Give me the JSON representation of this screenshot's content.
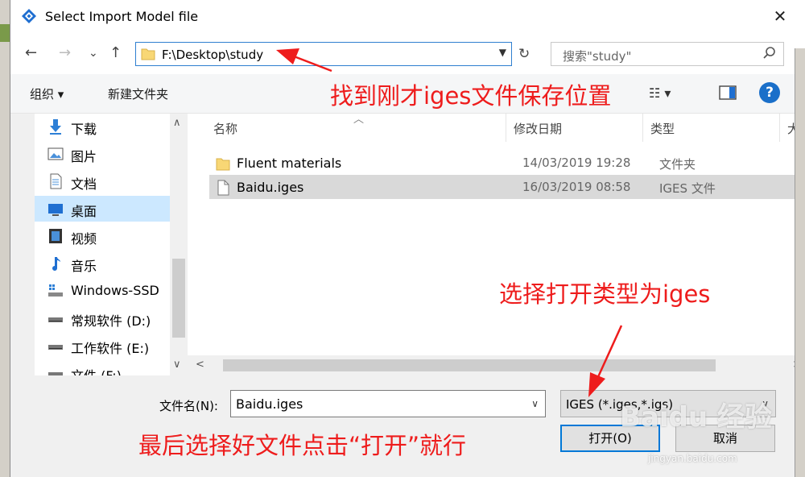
{
  "window": {
    "title": "Select Import Model file",
    "close_glyph": "✕"
  },
  "nav": {
    "back_glyph": "←",
    "forward_glyph": "→",
    "recent_glyph": "⌄",
    "up_glyph": "↑",
    "address_path": "F:\\Desktop\\study",
    "refresh_glyph": "↻",
    "search_placeholder": "搜索\"study\""
  },
  "toolbar": {
    "organize_label": "组织 ▾",
    "new_folder_label": "新建文件夹",
    "view_glyph": "☷ ▾",
    "help_glyph": "?"
  },
  "sidebar": {
    "items": [
      {
        "label": "下载",
        "icon": "download-icon"
      },
      {
        "label": "图片",
        "icon": "pictures-icon"
      },
      {
        "label": "文档",
        "icon": "documents-icon"
      },
      {
        "label": "桌面",
        "icon": "desktop-icon",
        "selected": true
      },
      {
        "label": "视频",
        "icon": "videos-icon"
      },
      {
        "label": "音乐",
        "icon": "music-icon"
      },
      {
        "label": "Windows-SSD",
        "icon": "drive-c-icon"
      },
      {
        "label": "常规软件 (D:)",
        "icon": "drive-icon"
      },
      {
        "label": "工作软件 (E:)",
        "icon": "drive-icon"
      },
      {
        "label": "文件 (F:)",
        "icon": "drive-icon"
      }
    ]
  },
  "filelist": {
    "columns": {
      "name": "名称",
      "modified": "修改日期",
      "type": "类型",
      "size": "大"
    },
    "rows": [
      {
        "name": "Fluent materials",
        "modified": "14/03/2019 19:28",
        "type": "文件夹",
        "icon": "folder-icon"
      },
      {
        "name": "Baidu.iges",
        "modified": "16/03/2019 08:58",
        "type": "IGES 文件",
        "icon": "file-icon",
        "selected": true
      }
    ]
  },
  "bottom": {
    "filename_label": "文件名(N):",
    "filename_value": "Baidu.iges",
    "filetype_value": "IGES (*.iges,*.igs)",
    "open_label": "打开(O)",
    "cancel_label": "取消"
  },
  "annotations": {
    "find_location": "找到刚才iges文件保存位置",
    "select_type": "选择打开类型为iges",
    "final_step": "最后选择好文件点击“打开”就行",
    "color": "#ee1c1c"
  },
  "watermark": {
    "brand": "Baidu 经验",
    "url": "jingyan.baidu.com"
  }
}
